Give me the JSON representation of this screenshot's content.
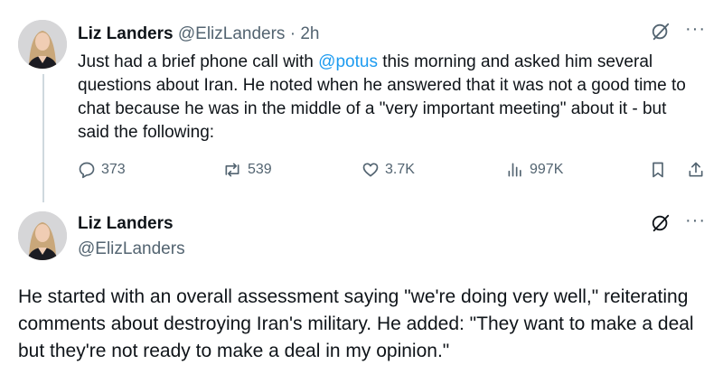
{
  "tweet1": {
    "name": "Liz Landers",
    "handle": "@ElizLanders",
    "separator": "·",
    "time": "2h",
    "text_before": "Just had a brief phone call with ",
    "mention": "@potus",
    "text_after": " this morning and asked him several questions about Iran. He noted when he answered that it was not a good time to chat because he was in the middle of a \"very important meeting\" about it - but said the following:",
    "replies": "373",
    "reposts": "539",
    "likes": "3.7K",
    "views": "997K"
  },
  "tweet2": {
    "name": "Liz Landers",
    "handle": "@ElizLanders",
    "text": "He started with an overall assessment saying \"we're doing very well,\" reiterating comments about destroying Iran's military. He added: \"They want to make a deal but they're not ready to make a deal in my opinion.\""
  },
  "more_label": "···",
  "colors": {
    "accent": "#1d9bf0",
    "muted": "#536471",
    "text": "#0f1419",
    "thread_line": "#cfd9de"
  }
}
